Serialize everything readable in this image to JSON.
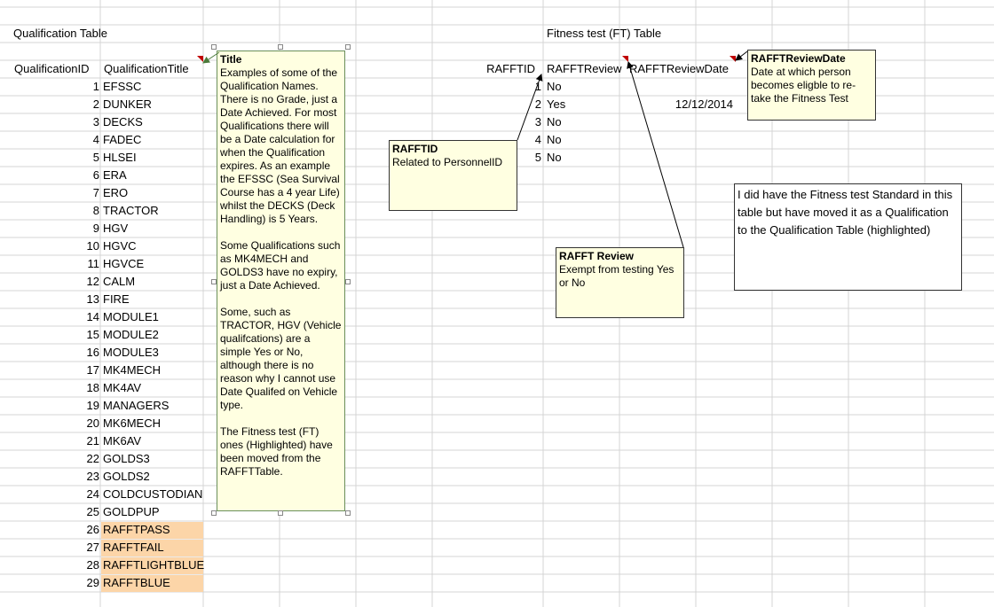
{
  "qualification": {
    "title": "Qualification Table",
    "headers": {
      "id": "QualificationID",
      "title": "QualificationTitle"
    },
    "rows": [
      {
        "id": "1",
        "title": "EFSSC"
      },
      {
        "id": "2",
        "title": "DUNKER"
      },
      {
        "id": "3",
        "title": "DECKS"
      },
      {
        "id": "4",
        "title": "FADEC"
      },
      {
        "id": "5",
        "title": "HLSEI"
      },
      {
        "id": "6",
        "title": "ERA"
      },
      {
        "id": "7",
        "title": "ERO"
      },
      {
        "id": "8",
        "title": "TRACTOR"
      },
      {
        "id": "9",
        "title": "HGV"
      },
      {
        "id": "10",
        "title": "HGVC"
      },
      {
        "id": "11",
        "title": "HGVCE"
      },
      {
        "id": "12",
        "title": "CALM"
      },
      {
        "id": "13",
        "title": "FIRE"
      },
      {
        "id": "14",
        "title": "MODULE1"
      },
      {
        "id": "15",
        "title": "MODULE2"
      },
      {
        "id": "16",
        "title": "MODULE3"
      },
      {
        "id": "17",
        "title": "MK4MECH"
      },
      {
        "id": "18",
        "title": "MK4AV"
      },
      {
        "id": "19",
        "title": "MANAGERS"
      },
      {
        "id": "20",
        "title": "MK6MECH"
      },
      {
        "id": "21",
        "title": "MK6AV"
      },
      {
        "id": "22",
        "title": "GOLDS3"
      },
      {
        "id": "23",
        "title": "GOLDS2"
      },
      {
        "id": "24",
        "title": "COLDCUSTODIAN"
      },
      {
        "id": "25",
        "title": "GOLDPUP"
      },
      {
        "id": "26",
        "title": "RAFFTPASS",
        "highlight": true
      },
      {
        "id": "27",
        "title": "RAFFTFAIL",
        "highlight": true
      },
      {
        "id": "28",
        "title": "RAFFTLIGHTBLUE",
        "highlight": true
      },
      {
        "id": "29",
        "title": "RAFFTBLUE",
        "highlight": true
      }
    ]
  },
  "title_comment": {
    "heading": "Title",
    "p1": "Examples of some of the Qualification Names. There is no Grade, just a Date Achieved. For most Qualifications there will be a Date calculation for when the Qualification expires. As an example the EFSSC (Sea Survival Course has a 4 year Life) whilst the DECKS (Deck Handling) is 5 Years.",
    "p2": "Some Qualifications such as MK4MECH and GOLDS3 have no expiry, just a Date Achieved.",
    "p3": "Some, such as TRACTOR, HGV (Vehicle qualifcations) are a simple Yes or No, although there is no reason why I cannot use Date Qualifed on Vehicle type.",
    "p4": "The Fitness test (FT) ones (Highlighted) have been moved from the RAFFTTable."
  },
  "fitness": {
    "title": "Fitness test (FT) Table",
    "headers": {
      "id": "RAFFTID",
      "review": "RAFFTReview",
      "date": "RAFFTReviewDate"
    },
    "rows": [
      {
        "id": "1",
        "review": "No",
        "date": ""
      },
      {
        "id": "2",
        "review": "Yes",
        "date": "12/12/2014"
      },
      {
        "id": "3",
        "review": "No",
        "date": ""
      },
      {
        "id": "4",
        "review": "No",
        "date": ""
      },
      {
        "id": "5",
        "review": "No",
        "date": ""
      }
    ]
  },
  "comments": {
    "rafftid": {
      "heading": "RAFFTID",
      "body": "Related to PersonnelID"
    },
    "review": {
      "heading": "RAFFT Review",
      "body": "Exempt from testing Yes or No"
    },
    "reviewdate": {
      "heading": "RAFFTReviewDate",
      "body": "Date at which person becomes eligble to re-take the Fitness Test"
    }
  },
  "note": "I did have the Fitness test Standard in this table but have moved it as a Qualification to the Qualification Table (highlighted)",
  "colors": {
    "highlight": "#fcd5a8",
    "comment_bg": "#ffffe1",
    "gridline": "#d4d4d4",
    "indicator": "#c00000"
  }
}
